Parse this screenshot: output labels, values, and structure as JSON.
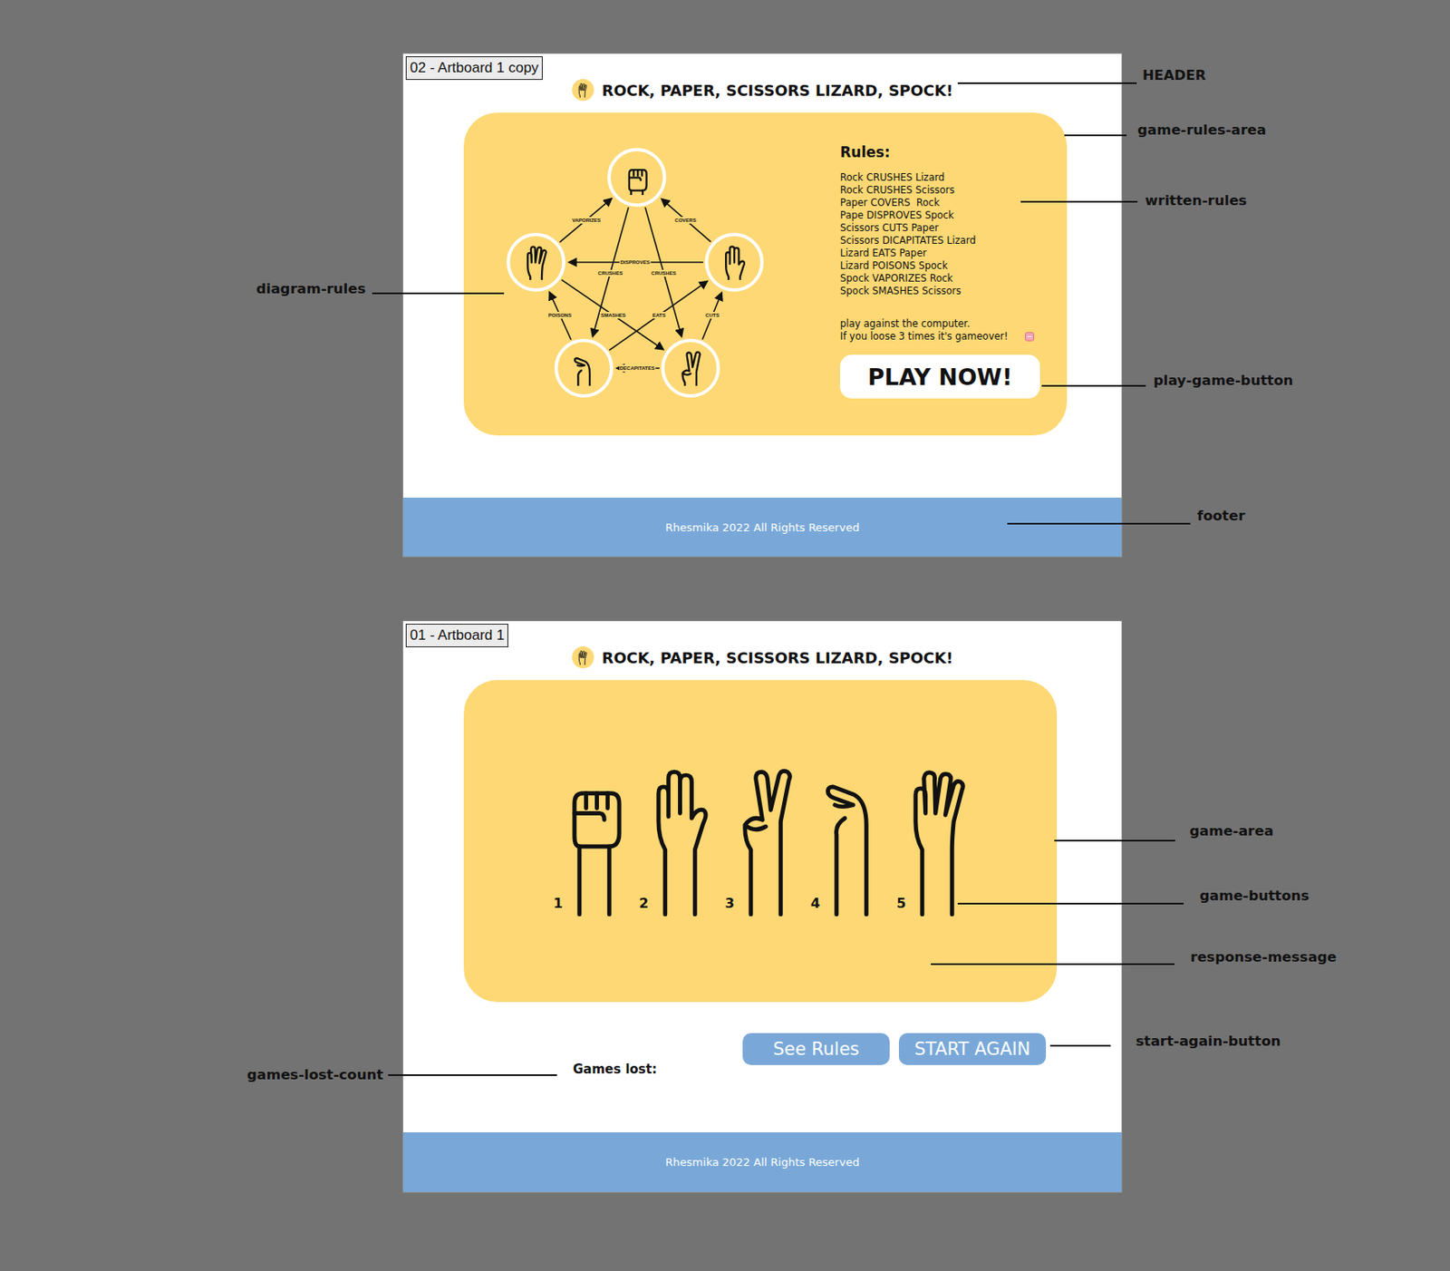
{
  "artboards": [
    {
      "label": "02 - Artboard 1 copy",
      "header": {
        "title": "ROCK, PAPER, SCISSORS LIZARD, SPOCK!"
      },
      "rules_area": {
        "diagram": {
          "edges": [
            {
              "label": "VAPORIZES",
              "from": 4,
              "to": 0
            },
            {
              "label": "COVERS",
              "from": 1,
              "to": 0
            },
            {
              "label": "DISPROVES",
              "from": 1,
              "to": 4
            },
            {
              "label": "CRUSHES",
              "from": 0,
              "to": 3
            },
            {
              "label": "CRUSHES",
              "from": 0,
              "to": 2
            },
            {
              "label": "SMASHES",
              "from": 4,
              "to": 2
            },
            {
              "label": "EATS",
              "from": 3,
              "to": 1
            },
            {
              "label": "POISONS",
              "from": 3,
              "to": 4
            },
            {
              "label": "CUTS",
              "from": 2,
              "to": 1
            },
            {
              "label": "DECAPITATES",
              "from": 2,
              "to": 3
            }
          ]
        },
        "heading": "Rules:",
        "rules": [
          "Rock CRUSHES Lizard",
          "Rock CRUSHES Scissors",
          "Paper COVERS  Rock",
          "Pape DISPROVES Spock",
          "Scissors CUTS Paper",
          "Scissors DICAPITATES Lizard",
          "Lizard EATS Paper",
          "Lizard POISONS Spock",
          "Spock VAPORIZES Rock",
          "Spock SMASHES Scissors"
        ],
        "notes": [
          "play against the computer.",
          "If you loose 3 times it's gameover!"
        ],
        "play_button": "PLAY NOW!"
      },
      "footer": "Rhesmika 2022 All Rights Reserved"
    },
    {
      "label": "01 - Artboard 1",
      "header": {
        "title": "ROCK, PAPER, SCISSORS LIZARD, SPOCK!"
      },
      "game_area": {
        "buttons": [
          {
            "number": "1"
          },
          {
            "number": "2"
          },
          {
            "number": "3"
          },
          {
            "number": "4"
          },
          {
            "number": "5"
          }
        ]
      },
      "games_lost": "Games lost:",
      "buttons": [
        "See Rules",
        "START AGAIN"
      ],
      "footer": "Rhesmika 2022 All Rights Reserved"
    }
  ],
  "annotations": [
    {
      "label": "HEADER"
    },
    {
      "label": "game-rules-area"
    },
    {
      "label": "written-rules"
    },
    {
      "label": "diagram-rules"
    },
    {
      "label": "play-game-button"
    },
    {
      "label": "footer"
    },
    {
      "label": "game-area"
    },
    {
      "label": "game-buttons"
    },
    {
      "label": "response-message"
    },
    {
      "label": "start-again-button"
    },
    {
      "label": "games-lost-count"
    }
  ]
}
